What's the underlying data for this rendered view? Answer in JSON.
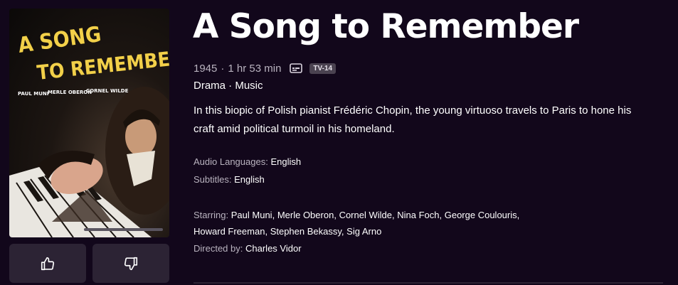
{
  "poster": {
    "title_line1": "A SONG",
    "title_line2": "TO REMEMBER",
    "cast": [
      "PAUL MUNI",
      "MERLE OBERON",
      "CORNEL WILDE"
    ]
  },
  "title": "A Song to Remember",
  "meta": {
    "year": "1945",
    "separator": "·",
    "duration": "1 hr 53 min",
    "cc_icon": "closed-captions-icon",
    "rating": "TV-14"
  },
  "genres": "Drama · Music",
  "description": "In this biopic of Polish pianist Frédéric Chopin, the young virtuoso travels to Paris to hone his craft amid political turmoil in his homeland.",
  "audio": {
    "label": "Audio Languages:",
    "value": "English"
  },
  "subtitles": {
    "label": "Subtitles:",
    "value": "English"
  },
  "starring": {
    "label": "Starring:",
    "names": [
      "Paul Muni",
      "Merle Oberon",
      "Cornel Wilde",
      "Nina Foch",
      "George Coulouris",
      "Howard Freeman",
      "Stephen Bekassy",
      "Sig Arno"
    ]
  },
  "directed": {
    "label": "Directed by:",
    "value": "Charles Vidor"
  },
  "actions": {
    "like_icon": "thumbs-up-icon",
    "dislike_icon": "thumbs-down-icon"
  },
  "colors": {
    "background": "#12071b",
    "button": "#2c2334",
    "muted_text": "#b9b3bf",
    "poster_title": "#f2d049"
  }
}
